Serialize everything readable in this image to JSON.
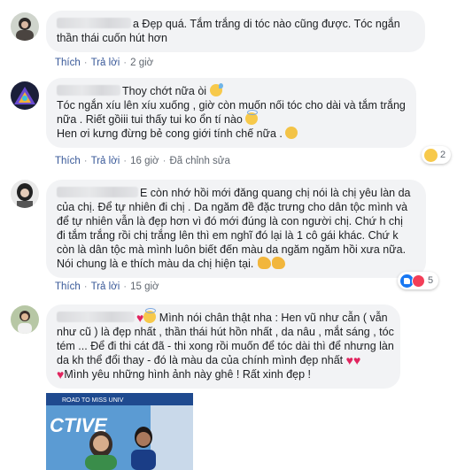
{
  "actions": {
    "like": "Thích",
    "reply": "Trả lời",
    "edited": "Đã chỉnh sửa"
  },
  "comments": [
    {
      "lines": [
        "a Đẹp quá. Tắm trắng di tóc nào cũng được. Tóc ngắn",
        "thần thái cuốn hút hơn"
      ],
      "time": "2 giờ"
    },
    {
      "lines": [
        "Thoy chớt nữa òi",
        "Tóc ngắn xíu lên xíu xuống , giờ còn muốn nối tóc cho dài và tắm trắng",
        "nữa . Riết gồiii tui thấy tui ko ổn tí nào",
        "Hen ơi kưng đừng bẻ cong giới tính chế nữa ."
      ],
      "time": "16 giờ",
      "reaction_count": "2"
    },
    {
      "lines": [
        "E còn nhớ hồi mới đăng quang chị nói là chị yêu làn da",
        "của chị. Để tự nhiên đi chị . Da ngăm đề đặc trưng cho dân tộc mình và",
        "để tự nhiên vẫn là đẹp hơn vì đó mới đúng là con người chị. Chứ h chị",
        "đi tắm trắng rồi chị trắng lên thì em nghĩ đó lại là 1 cô gái khác. Chứ k",
        "còn là dân tộc mà mình luôn biết đến màu da ngăm ngăm hồi xưa nữa.",
        "Nói chung là e thích màu da chị hiện tại."
      ],
      "time": "15 giờ",
      "reaction_count": "5"
    },
    {
      "lines": [
        "Mình nói chân thật nha : Hen vũ như cẫn ( vẫn",
        "như cũ ) là đẹp nhất , thần thái hút hồn nhất , da nâu , mắt sáng , tóc",
        "tém ... Để đi thi cát đã - thi xong rồi muốn để tóc dài thì để nhưng làn",
        "da kh thể đổi thay - đó là màu da của chính mình đẹp nhất",
        "Mình yêu những hình ảnh này ghê ! Rất xinh đẹp !"
      ]
    }
  ],
  "photo": {
    "banner_text": "ROAD TO MISS UNIV",
    "sign_text": "CTIVE"
  },
  "colors": {
    "bubble": "#f2f3f5",
    "link": "#385898",
    "meta": "#606770",
    "heart": "#e0245e",
    "like_blue": "#1877f2"
  }
}
